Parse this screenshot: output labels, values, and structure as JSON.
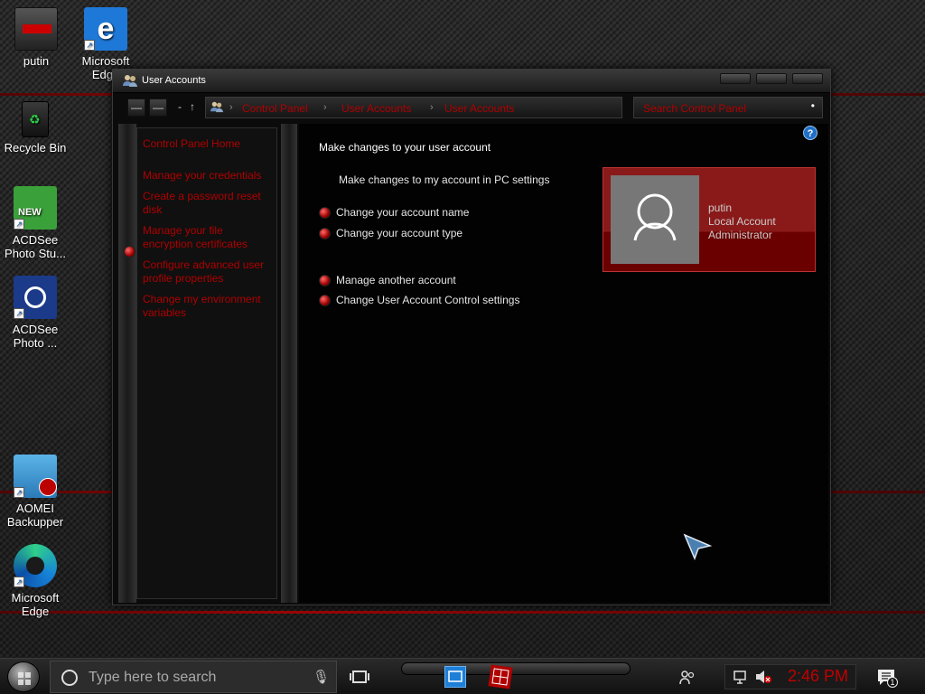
{
  "desktop": {
    "icons": [
      {
        "label": "putin"
      },
      {
        "label": "Microsoft Edge"
      },
      {
        "label": "Recycle Bin"
      },
      {
        "label": "ACDSee Photo Stu..."
      },
      {
        "label": "ACDSee Photo ..."
      },
      {
        "label": "AOMEI Backupper"
      },
      {
        "label": "Microsoft Edge"
      }
    ]
  },
  "window": {
    "title": "User Accounts",
    "breadcrumbs": [
      "Control Panel",
      "User Accounts",
      "User Accounts"
    ],
    "search_placeholder": "Search Control Panel",
    "left_pane": {
      "home": "Control Panel Home",
      "links": [
        "Manage your credentials",
        "Create a password reset disk",
        "Manage your file encryption certificates",
        "Configure advanced user profile properties",
        "Change my environment variables"
      ]
    },
    "content": {
      "heading": "Make changes to your user account",
      "tasks": [
        "Make changes to my account in PC settings",
        "Change your account name",
        "Change your account type",
        "Manage another account",
        "Change User Account Control settings"
      ],
      "help": "?"
    },
    "account": {
      "name": "putin",
      "type": "Local Account",
      "role": "Administrator"
    }
  },
  "taskbar": {
    "search_placeholder": "Type here to search",
    "clock": "2:46 PM",
    "notification_count": "1"
  },
  "colors": {
    "accent": "#b00000",
    "card": "#8a1a1a"
  }
}
